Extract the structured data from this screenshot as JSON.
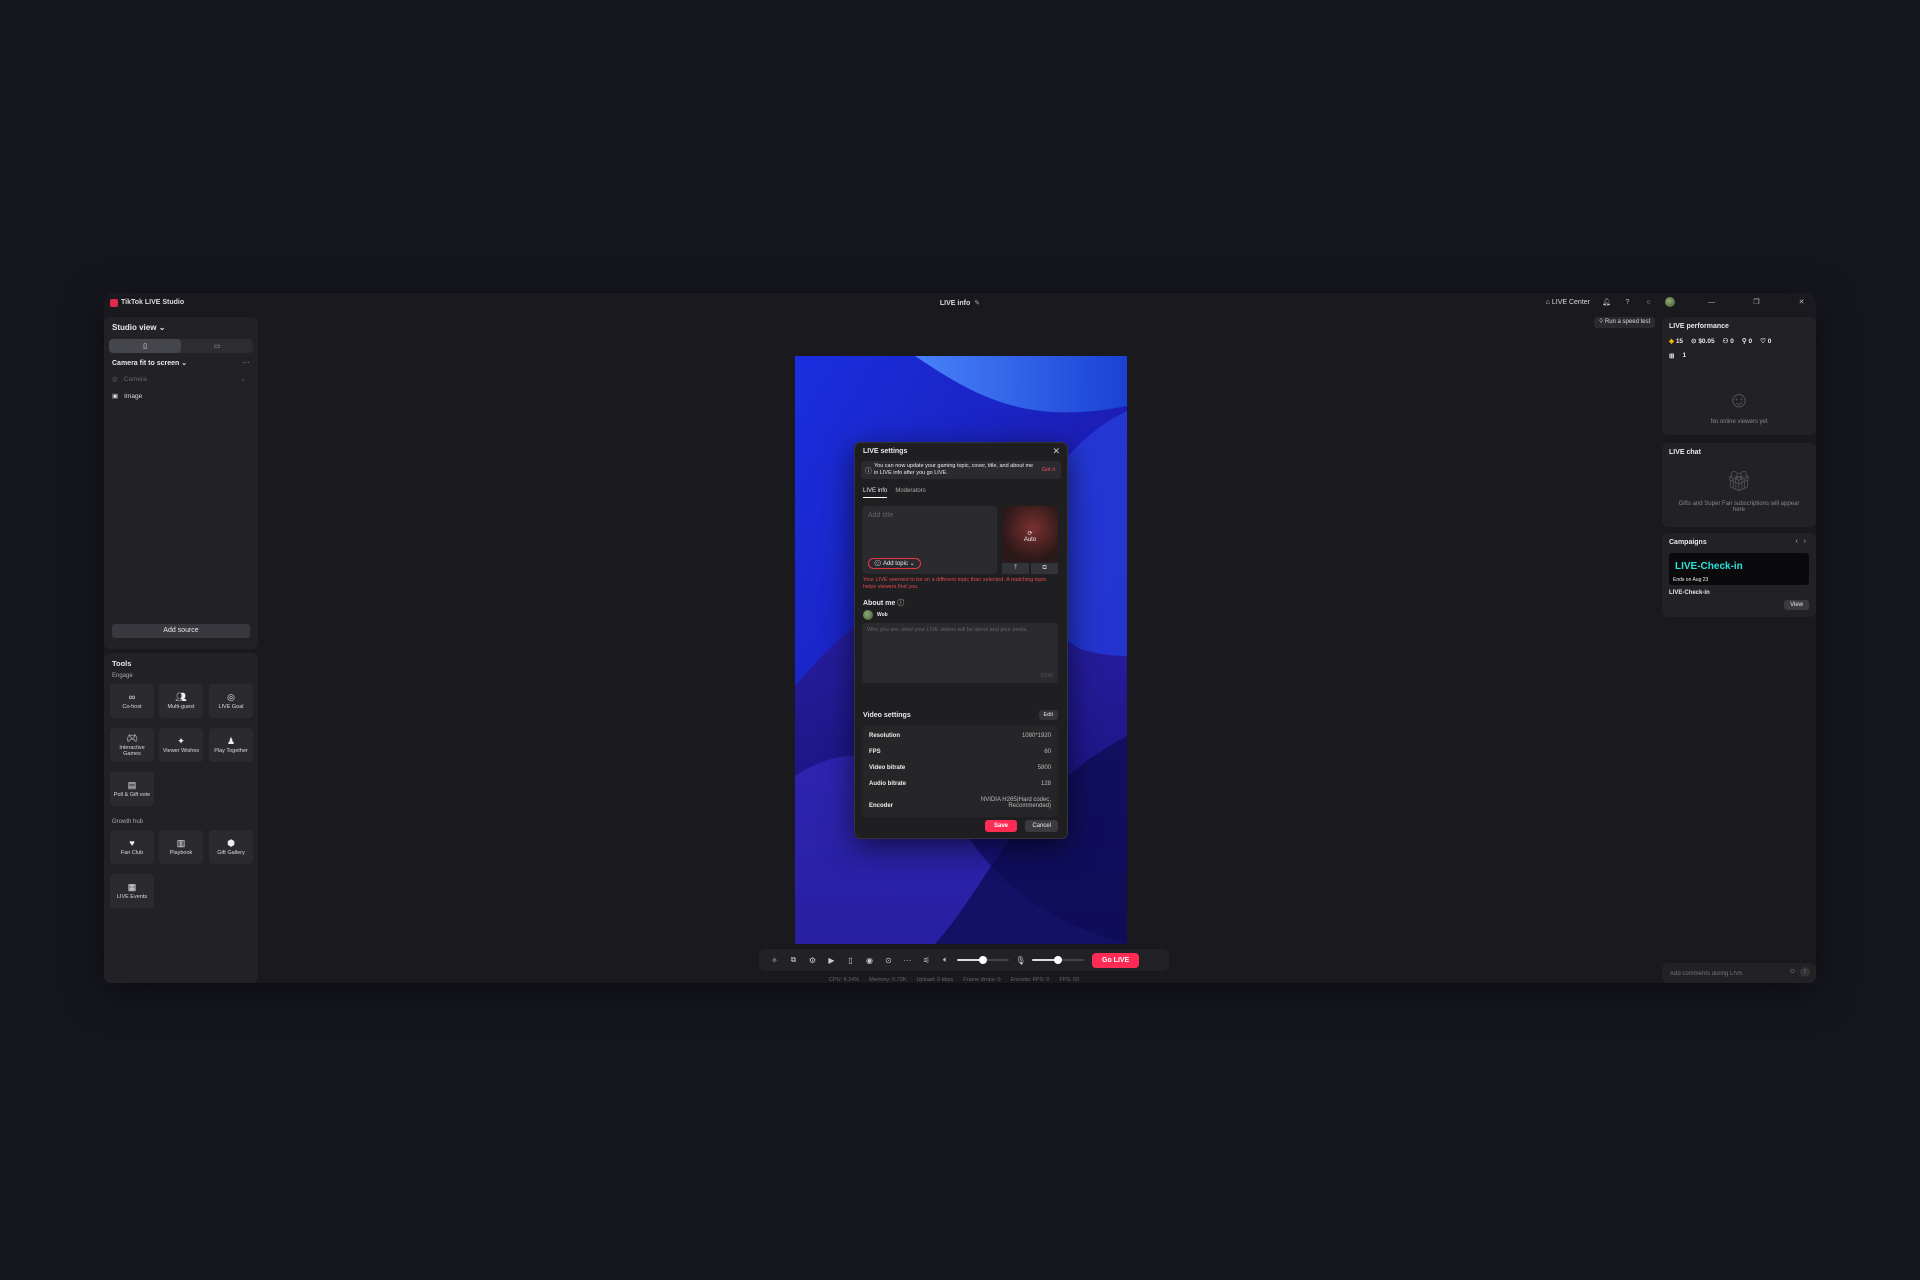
{
  "titlebar": {
    "app_name": "TikTok LIVE Studio",
    "center_title": "LIVE info",
    "center_icon": "pencil-icon",
    "live_center": "LIVE Center",
    "window_controls": [
      "minimize",
      "restore",
      "close"
    ]
  },
  "left": {
    "studio_view": "Studio view",
    "scene": "Camera fit to screen",
    "sources": [
      {
        "label": "Camera",
        "icon": "camera-icon"
      },
      {
        "label": "Image",
        "icon": "image-icon"
      }
    ],
    "add_source": "Add source"
  },
  "tools": {
    "title": "Tools",
    "engage_label": "Engage",
    "engage": [
      {
        "label": "Co-host",
        "icon": "co-host-icon"
      },
      {
        "label": "Multi-guest",
        "icon": "multi-guest-icon"
      },
      {
        "label": "LIVE Goal",
        "icon": "goal-icon"
      },
      {
        "label": "Interactive Games",
        "icon": "gamepad-icon"
      },
      {
        "label": "Viewer Wishes",
        "icon": "gift-icon"
      },
      {
        "label": "Play Together",
        "icon": "play-together-icon"
      },
      {
        "label": "Poll & Gift vote",
        "icon": "poll-icon"
      }
    ],
    "growth_label": "Growth hub",
    "growth": [
      {
        "label": "Fan Club",
        "icon": "heart-icon"
      },
      {
        "label": "Playbook",
        "icon": "book-icon"
      },
      {
        "label": "Gift Gallery",
        "icon": "gallery-icon"
      },
      {
        "label": "LIVE Events",
        "icon": "calendar-icon"
      }
    ]
  },
  "modal": {
    "title": "LIVE settings",
    "banner_text": "You can now update your gaming topic, cover, title, and about me in LIVE info after you go LIVE.",
    "banner_action": "Got it",
    "tabs": [
      "LIVE info",
      "Moderators"
    ],
    "title_placeholder": "Add title",
    "add_topic": "Add topic",
    "cover_label": "Auto",
    "warning": "Your LIVE seemed to be on a different topic than selected. A matching topic helps viewers find you.",
    "about_title": "About me",
    "username": "Wob",
    "about_placeholder": "Who you are, what your LIVE videos will be about and your perks.",
    "about_counter": "0/240",
    "video_settings_title": "Video settings",
    "edit": "Edit",
    "settings": [
      {
        "key": "Resolution",
        "value": "1080*1920"
      },
      {
        "key": "FPS",
        "value": "60"
      },
      {
        "key": "Video bitrate",
        "value": "5800"
      },
      {
        "key": "Audio bitrate",
        "value": "128"
      },
      {
        "key": "Encoder",
        "value": "NVIDIA H265(Hard codec, Recommended)"
      }
    ],
    "save": "Save",
    "cancel": "Cancel"
  },
  "toolbar": {
    "go_live": "Go LIVE",
    "volume_level": 0.5,
    "mic_level": 0.5
  },
  "status": {
    "cpu": "CPU: 6.24%",
    "memory": "Memory: 0.72K",
    "upload": "Upload: 0 kbps",
    "frame_drops": "Frame drops: 0",
    "encoder_fps": "Encoder FPS: 0",
    "fps": "FPS: 60"
  },
  "right": {
    "speed_test": "Run a speed test",
    "performance_title": "LIVE performance",
    "stats": {
      "diamonds": "15",
      "revenue": "$0.05",
      "viewers": "0",
      "new_followers": "0",
      "likes": "0",
      "gifters": "1"
    },
    "no_viewers": "No online viewers yet",
    "chat_title": "LIVE chat",
    "chat_empty": "Gifts and Super Fan subscriptions will appear here",
    "campaigns_title": "Campaigns",
    "banner_big": "LIVE-Check-in",
    "banner_small": "Ends on Aug 23",
    "campaign_name": "LIVE-Check-in",
    "view": "View",
    "comment_placeholder": "Add comments during LIVE"
  },
  "colors": {
    "accent": "#fe2c55",
    "campaign": "#2ee0d7",
    "warning": "#e24a4a"
  }
}
